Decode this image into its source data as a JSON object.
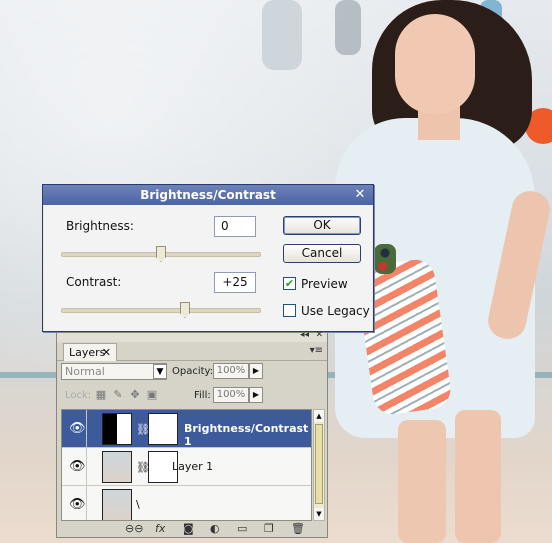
{
  "dialog": {
    "title": "Brightness/Contrast",
    "close_glyph": "✕",
    "brightness_label": "Brightness:",
    "brightness_value": "0",
    "brightness_slider": 0.5,
    "contrast_label": "Contrast:",
    "contrast_value": "+25",
    "contrast_slider": 0.62,
    "ok_label": "OK",
    "cancel_label": "Cancel",
    "preview_label": "Preview",
    "preview_checked": true,
    "use_legacy_label": "Use Legacy",
    "use_legacy_checked": false
  },
  "layers_panel": {
    "tab_label": "Layers",
    "tab_close": "✕",
    "collapse_glyph": "◂◂",
    "close_glyph": "✕",
    "menu_glyph": "▾≡",
    "blend_mode": "Normal",
    "opacity_label": "Opacity:",
    "opacity_value": "100%",
    "lock_label": "Lock:",
    "fill_label": "Fill:",
    "fill_value": "100%",
    "layers": [
      {
        "name": "Brightness/Contrast 1",
        "selected": true,
        "type": "adjustment"
      },
      {
        "name": "Layer 1",
        "selected": false,
        "type": "pixel-with-mask"
      },
      {
        "name": "\\",
        "selected": false,
        "type": "background"
      }
    ],
    "bottom_icons": [
      "link-icon",
      "fx-icon",
      "mask-icon",
      "adjustment-icon",
      "folder-icon",
      "new-layer-icon",
      "trash-icon"
    ],
    "bottom_labels": [
      "⊖⊖",
      "fx",
      "◙",
      "◐",
      "▭",
      "❐",
      "🗑"
    ]
  },
  "colors": {
    "title_bar": "#4b64a3",
    "selected_layer": "#3d5a9b",
    "dialog_bg": "#f3f3f3",
    "panel_bg": "#d6d3c9"
  }
}
